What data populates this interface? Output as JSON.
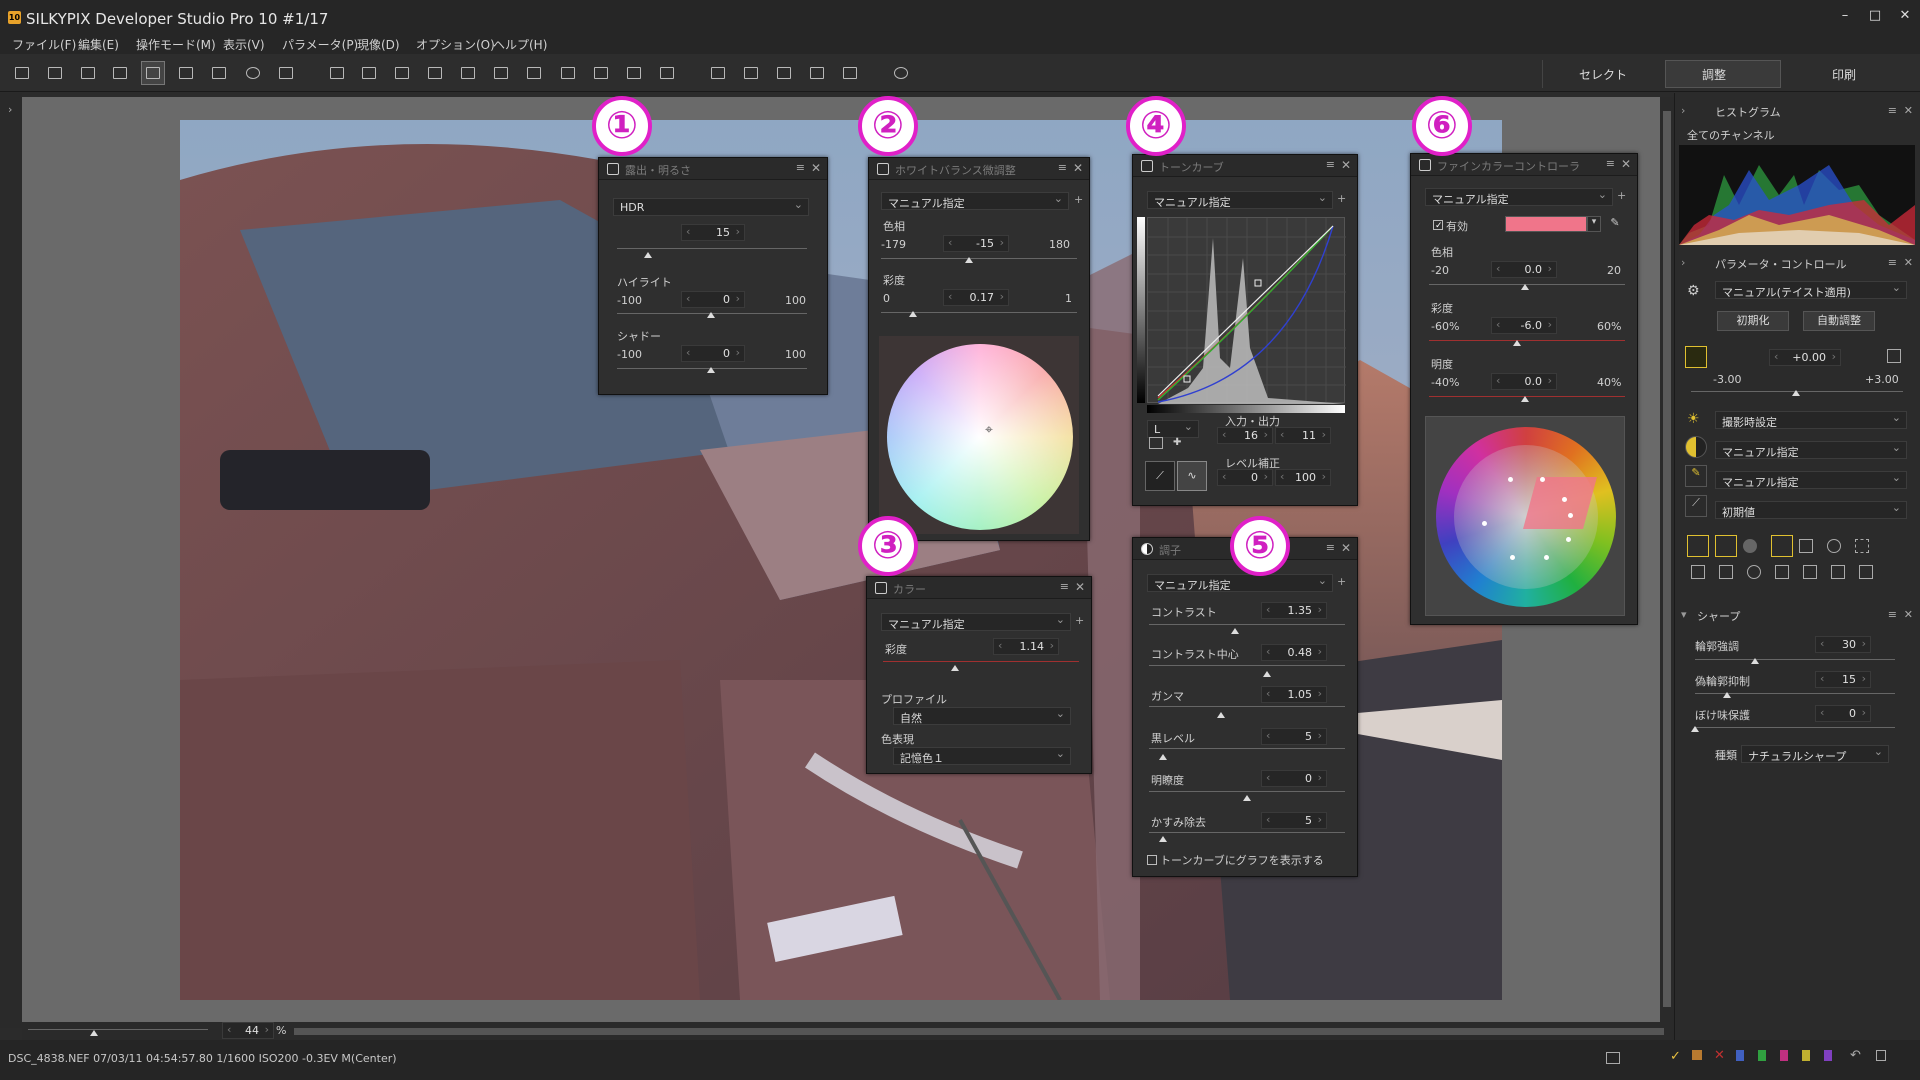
{
  "app": {
    "title": "SILKYPIX Developer Studio Pro 10   #1/17",
    "logo": "10"
  },
  "menu": [
    "ファイル(F)",
    "編集(E)",
    "操作モード(M)",
    "表示(V)",
    "パラメータ(P)",
    "現像(D)",
    "オプション(O)",
    "ヘルプ(H)"
  ],
  "modes": {
    "select": "セレクト",
    "adjust": "調整",
    "print": "印刷"
  },
  "zoom": {
    "value": "44",
    "unit": "%"
  },
  "status": {
    "text": "DSC_4838.NEF 07/03/11 04:54:57.80 1/1600 ISO200 -0.3EV M(Center)"
  },
  "badges": [
    "①",
    "②",
    "③",
    "④",
    "⑤",
    "⑥"
  ],
  "panel1": {
    "title": "露出・明るさ",
    "mode": "HDR",
    "hdr_value": "15",
    "highlight": {
      "label": "ハイライト",
      "min": "-100",
      "value": "0",
      "max": "100"
    },
    "shadow": {
      "label": "シャドー",
      "min": "-100",
      "value": "0",
      "max": "100"
    }
  },
  "panel2": {
    "title": "ホワイトバランス微調整",
    "mode": "マニュアル指定",
    "hue": {
      "label": "色相",
      "min": "-179",
      "value": "-15",
      "max": "180"
    },
    "saturation": {
      "label": "彩度",
      "min": "0",
      "value": "0.17",
      "max": "1"
    }
  },
  "panel3": {
    "title": "カラー",
    "mode": "マニュアル指定",
    "saturation": {
      "label": "彩度",
      "value": "1.14"
    },
    "profile_label": "プロファイル",
    "profile": "自然",
    "color_label": "色表現",
    "color": "記憶色１"
  },
  "panel4": {
    "title": "トーンカーブ",
    "mode": "マニュアル指定",
    "channel": "L",
    "io_label": "入力・出力",
    "input": "16",
    "output": "11",
    "level_label": "レベル補正",
    "level_low": "0",
    "level_high": "100"
  },
  "panel5": {
    "title": "調子",
    "mode": "マニュアル指定",
    "rows": [
      {
        "label": "コントラスト",
        "value": "1.35"
      },
      {
        "label": "コントラスト中心",
        "value": "0.48"
      },
      {
        "label": "ガンマ",
        "value": "1.05"
      },
      {
        "label": "黒レベル",
        "value": "5"
      },
      {
        "label": "明瞭度",
        "value": "0"
      },
      {
        "label": "かすみ除去",
        "value": "5"
      }
    ],
    "checkbox": "トーンカーブにグラフを表示する"
  },
  "panel6": {
    "title": "ファインカラーコントローラ",
    "mode": "マニュアル指定",
    "enabled": "有効",
    "swatch": "#f0758a",
    "hue": {
      "label": "色相",
      "min": "-20",
      "value": "0.0",
      "max": "20"
    },
    "saturation": {
      "label": "彩度",
      "min": "-60%",
      "value": "-6.0",
      "max": "60%"
    },
    "brightness": {
      "label": "明度",
      "min": "-40%",
      "value": "0.0",
      "max": "40%"
    }
  },
  "right": {
    "histogram": "ヒストグラム",
    "channels": "全てのチャンネル",
    "param": "パラメータ・コントロール",
    "taste": "マニュアル(テイスト適用)",
    "init": "初期化",
    "auto": "自動調整",
    "ev": "+0.00",
    "ev_min": "-3.00",
    "ev_max": "+3.00",
    "rows": [
      "撮影時設定",
      "マニュアル指定",
      "マニュアル指定",
      "初期値"
    ],
    "sharp": "シャープ",
    "sharp_rows": [
      {
        "label": "輪郭強調",
        "value": "30"
      },
      {
        "label": "偽輪郭抑制",
        "value": "15"
      },
      {
        "label": "ぼけ味保護",
        "value": "0"
      }
    ],
    "type_label": "種類",
    "type": "ナチュラルシャープ"
  }
}
